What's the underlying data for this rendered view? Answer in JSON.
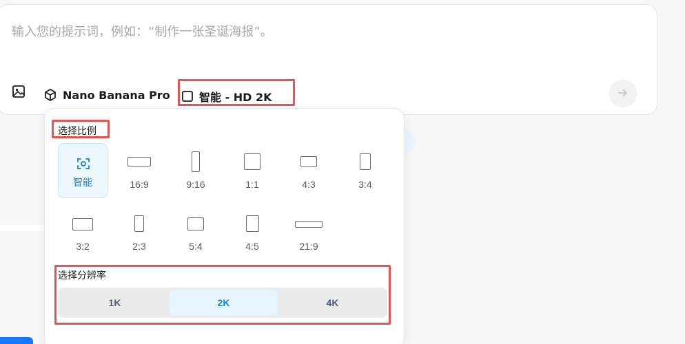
{
  "prompt": {
    "placeholder": "输入您的提示词，例如：“制作一张圣诞海报”。"
  },
  "toolbar": {
    "model_label": "Nano Banana Pro",
    "quality_label": "智能 - HD 2K"
  },
  "popover": {
    "ratio_title": "选择比例",
    "ratios": [
      {
        "label": "智能",
        "selected": true
      },
      {
        "label": "16:9"
      },
      {
        "label": "9:16"
      },
      {
        "label": "1:1"
      },
      {
        "label": "4:3"
      },
      {
        "label": "3:4"
      },
      {
        "label": "3:2"
      },
      {
        "label": "2:3"
      },
      {
        "label": "5:4"
      },
      {
        "label": "4:5"
      },
      {
        "label": "21:9"
      }
    ],
    "resolution_title": "选择分辨率",
    "resolutions": [
      {
        "label": "1K"
      },
      {
        "label": "2K",
        "selected": true
      },
      {
        "label": "4K"
      }
    ]
  },
  "colors": {
    "accent": "#1a7fd6",
    "highlight": "#e85252"
  }
}
